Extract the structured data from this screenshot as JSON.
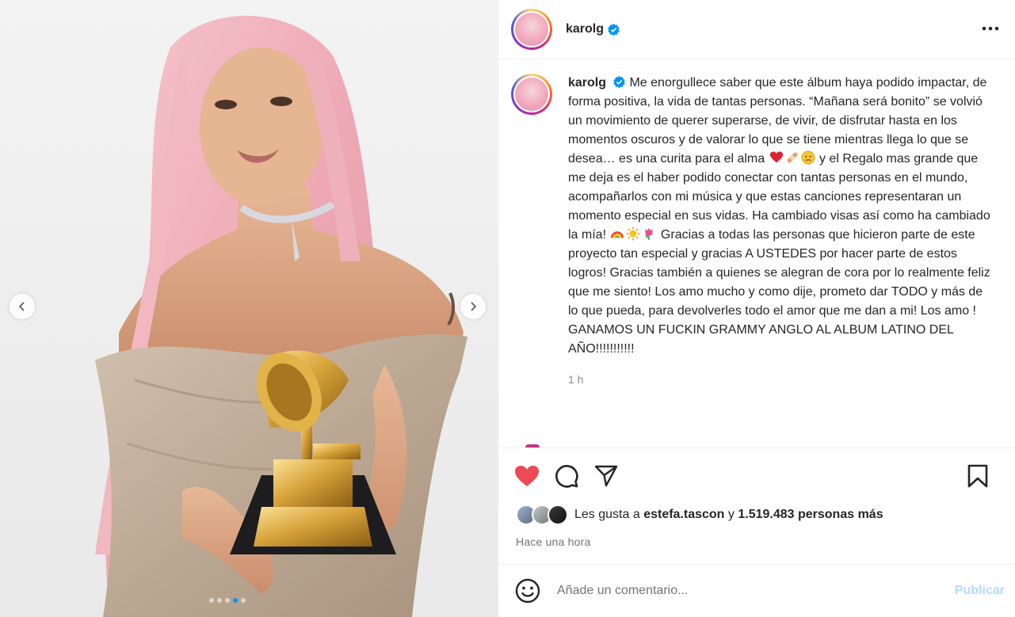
{
  "media": {
    "alt_icon_prev": "chevron-left-icon",
    "alt_icon_next": "chevron-right-icon",
    "carousel_dot_count": 5,
    "carousel_active_index": 3
  },
  "post": {
    "author": {
      "username": "karolg",
      "verified": true
    },
    "caption": {
      "part1": "Me enorgullece saber que este álbum haya podido impactar, de forma positiva, la vida de tantas personas. “Mañana será bonito” se volvió un movimiento de querer superarse, de vivir, de disfrutar hasta en los momentos oscuros y de valorar lo que se tiene mientras llega lo que se desea… es una curita para el alma ",
      "emojis1": [
        "red-heart-emoji",
        "bandage-emoji",
        "worried-face-emoji"
      ],
      "part2": " y el Regalo mas grande que me deja es el haber podido conectar con tantas personas en el mundo, acompañarlos con mi música y que estas canciones representaran un momento especial en sus vidas. Ha cambiado visas así como ha cambiado la mía! ",
      "emojis2": [
        "rainbow-emoji",
        "sun-emoji",
        "tulip-emoji"
      ],
      "part3": " Gracias a todas las personas que hicieron parte de este proyecto tan especial y gracias A USTEDES por hacer parte de estos logros! Gracias también a quienes se alegran de cora por lo realmente feliz que me siento! Los amo mucho y como dije, prometo dar TODO y más de lo que pueda, para devolverles todo el amor que me dan a mi! Los amo ! GANAMOS UN FUCKIN GRAMMY ANGLO AL ALBUM LATINO DEL AÑO!!!!!!!!!!!"
    },
    "caption_time": "1 h",
    "likes": {
      "prefix": "Les gusta a",
      "user": "estefa.tascon",
      "connector": "y",
      "count_text": "1.519.483 personas más"
    },
    "posted": "Hace una hora"
  },
  "actions": {
    "like_icon": "heart-filled-icon",
    "comment_icon": "comment-icon",
    "share_icon": "share-icon",
    "save_icon": "bookmark-icon",
    "liked": true
  },
  "comment_box": {
    "placeholder": "Añade un comentario...",
    "publish_label": "Publicar"
  },
  "colors": {
    "like_red": "#ed4956",
    "verified_blue": "#0095f6",
    "publish_disabled": "#b3dbff",
    "muted_text": "#8e8e8e"
  }
}
